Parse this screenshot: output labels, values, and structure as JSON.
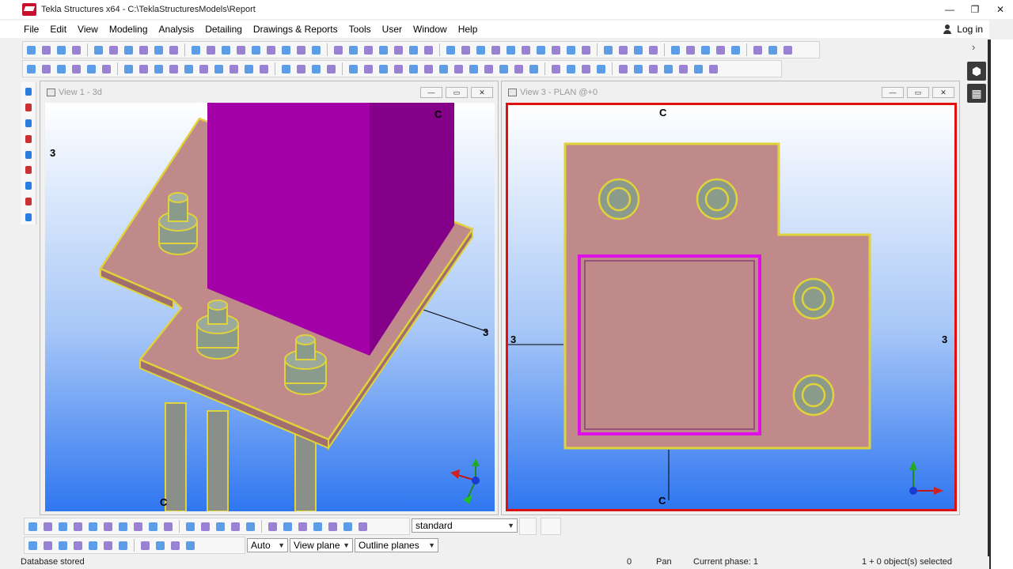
{
  "app": {
    "title": "Tekla Structures x64 - C:\\TeklaStructuresModels\\Report"
  },
  "window_controls": {
    "minimize": "—",
    "restore": "❐",
    "close": "✕"
  },
  "menu": [
    "File",
    "Edit",
    "View",
    "Modeling",
    "Analysis",
    "Detailing",
    "Drawings & Reports",
    "Tools",
    "User",
    "Window",
    "Help"
  ],
  "login": {
    "label": "Log in"
  },
  "views": {
    "view1": {
      "title": "View 1 - 3d",
      "grid_labels": {
        "top_c": "C",
        "left_3": "3",
        "right_3": "3",
        "bottom_c": "C"
      }
    },
    "view3": {
      "title": "View 3 - PLAN @+0",
      "grid_labels": {
        "top_c": "C",
        "left_3": "3",
        "right_3": "3",
        "bottom_c": "C"
      }
    },
    "view_buttons": {
      "minimize": "—",
      "restore": "▭",
      "close": "✕"
    }
  },
  "selection_toolbar": {
    "filter_value": "standard"
  },
  "snap_toolbar": {
    "depth_value": "Auto",
    "plane_value": "View plane",
    "outline_value": "Outline planes"
  },
  "statusbar": {
    "message": "Database stored",
    "count": "0",
    "mode": "Pan",
    "phase": "Current phase: 1",
    "selection": "1 + 0 object(s) selected"
  },
  "colors": {
    "plate": "#c08a8a",
    "plate_edge": "#e0d23a",
    "column": "#a400a8",
    "column_side": "#850088",
    "view_bg_top": "#ffffff",
    "view_bg_bottom": "#3a7ef2",
    "active_view_border": "#e01010"
  }
}
